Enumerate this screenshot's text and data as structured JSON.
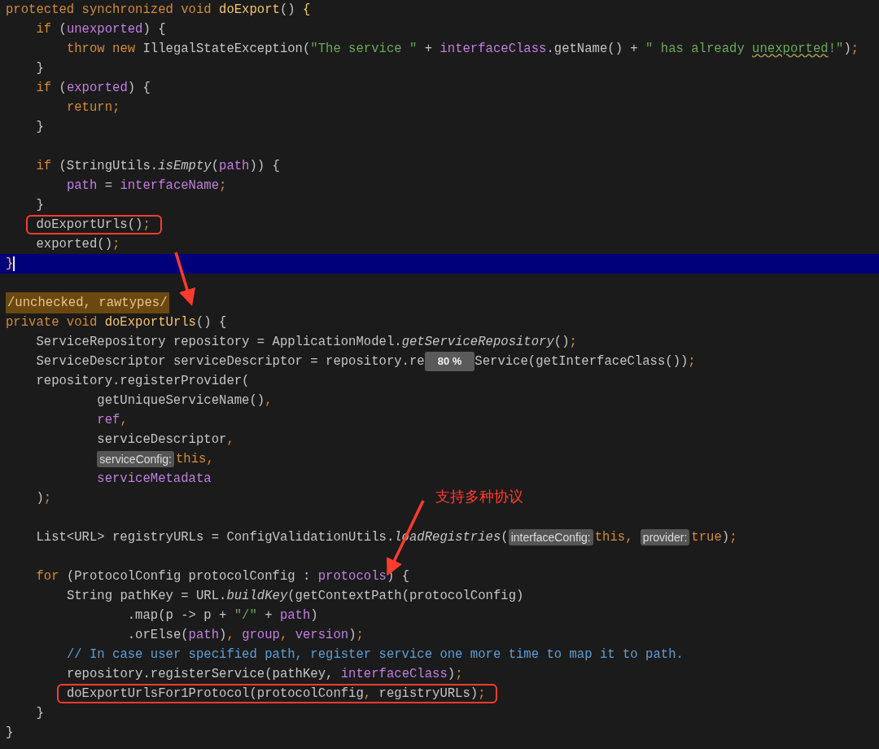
{
  "editor": {
    "lines": [
      {
        "kind": "code",
        "tokens": [
          {
            "kind": "kw",
            "text": "protected synchronized void "
          },
          {
            "kind": "fn",
            "text": "doExport"
          },
          {
            "kind": "plain",
            "text": "() "
          },
          {
            "kind": "fn",
            "text": "{"
          }
        ]
      },
      {
        "kind": "code",
        "tokens": [
          {
            "kind": "kw",
            "text": "    if "
          },
          {
            "kind": "plain",
            "text": "("
          },
          {
            "kind": "field",
            "text": "unexported"
          },
          {
            "kind": "plain",
            "text": ") {"
          }
        ]
      },
      {
        "kind": "code",
        "tokens": [
          {
            "kind": "kw",
            "text": "        throw new "
          },
          {
            "kind": "plain",
            "text": "IllegalStateException("
          },
          {
            "kind": "str",
            "text": "\"The service \""
          },
          {
            "kind": "plain",
            "text": " + "
          },
          {
            "kind": "field",
            "text": "interfaceClass"
          },
          {
            "kind": "plain",
            "text": ".getName() + "
          },
          {
            "kind": "str",
            "text": "\" has already "
          },
          {
            "kind": "strw",
            "text": "unexported"
          },
          {
            "kind": "str",
            "text": "!\""
          },
          {
            "kind": "plain",
            "text": ")"
          },
          {
            "kind": "punct",
            "text": ";"
          }
        ]
      },
      {
        "kind": "code",
        "tokens": [
          {
            "kind": "plain",
            "text": "    }"
          }
        ]
      },
      {
        "kind": "code",
        "tokens": [
          {
            "kind": "kw",
            "text": "    if "
          },
          {
            "kind": "plain",
            "text": "("
          },
          {
            "kind": "field",
            "text": "exported"
          },
          {
            "kind": "plain",
            "text": ") {"
          }
        ]
      },
      {
        "kind": "code",
        "tokens": [
          {
            "kind": "kw",
            "text": "        return;"
          }
        ]
      },
      {
        "kind": "code",
        "tokens": [
          {
            "kind": "plain",
            "text": "    }"
          }
        ]
      },
      {
        "kind": "blank"
      },
      {
        "kind": "code",
        "tokens": [
          {
            "kind": "kw",
            "text": "    if "
          },
          {
            "kind": "plain",
            "text": "(StringUtils."
          },
          {
            "kind": "italic",
            "text": "isEmpty"
          },
          {
            "kind": "plain",
            "text": "("
          },
          {
            "kind": "field",
            "text": "path"
          },
          {
            "kind": "plain",
            "text": ")) {"
          }
        ]
      },
      {
        "kind": "code",
        "tokens": [
          {
            "kind": "field",
            "text": "        path"
          },
          {
            "kind": "plain",
            "text": " = "
          },
          {
            "kind": "field",
            "text": "interfaceName"
          },
          {
            "kind": "punct",
            "text": ";"
          }
        ]
      },
      {
        "kind": "code",
        "tokens": [
          {
            "kind": "plain",
            "text": "    }"
          }
        ]
      },
      {
        "kind": "boxed",
        "tokens": [
          {
            "kind": "plain",
            "text": "    doExportUrls()"
          },
          {
            "kind": "punct",
            "text": ";"
          }
        ]
      },
      {
        "kind": "code",
        "tokens": [
          {
            "kind": "plain",
            "text": "    exported()"
          },
          {
            "kind": "punct",
            "text": ";"
          }
        ]
      },
      {
        "kind": "current",
        "tokens": [
          {
            "kind": "fn",
            "text": "}"
          }
        ]
      },
      {
        "kind": "blank"
      },
      {
        "kind": "code",
        "tokens": [
          {
            "kind": "annotation",
            "text": "/unchecked, rawtypes/"
          }
        ]
      },
      {
        "kind": "code",
        "tokens": [
          {
            "kind": "kw",
            "text": "private void "
          },
          {
            "kind": "fn",
            "text": "doExportUrls"
          },
          {
            "kind": "plain",
            "text": "() {"
          }
        ]
      },
      {
        "kind": "code",
        "tokens": [
          {
            "kind": "plain",
            "text": "    ServiceRepository repository = ApplicationModel."
          },
          {
            "kind": "italic",
            "text": "getServiceRepository"
          },
          {
            "kind": "plain",
            "text": "()"
          },
          {
            "kind": "punct",
            "text": ";"
          }
        ]
      },
      {
        "kind": "code",
        "tokens": [
          {
            "kind": "plain",
            "text": "    ServiceDescriptor serviceDescriptor = repository.re"
          },
          {
            "kind": "badge",
            "text": "80 %"
          },
          {
            "kind": "plain",
            "text": "Service(getInterfaceClass())"
          },
          {
            "kind": "punct",
            "text": ";"
          }
        ]
      },
      {
        "kind": "code",
        "tokens": [
          {
            "kind": "plain",
            "text": "    repository.registerProvider("
          }
        ]
      },
      {
        "kind": "code",
        "tokens": [
          {
            "kind": "plain",
            "text": "            getUniqueServiceName()"
          },
          {
            "kind": "punct",
            "text": ","
          }
        ]
      },
      {
        "kind": "code",
        "tokens": [
          {
            "kind": "field",
            "text": "            ref"
          },
          {
            "kind": "punct",
            "text": ","
          }
        ]
      },
      {
        "kind": "code",
        "tokens": [
          {
            "kind": "plain",
            "text": "            serviceDescriptor"
          },
          {
            "kind": "punct",
            "text": ","
          }
        ]
      },
      {
        "kind": "code",
        "tokens": [
          {
            "kind": "hint",
            "text": "            serviceConfig:"
          },
          {
            "kind": "kw",
            "text": "this,"
          }
        ]
      },
      {
        "kind": "code",
        "tokens": [
          {
            "kind": "field",
            "text": "            serviceMetadata"
          }
        ]
      },
      {
        "kind": "code",
        "tokens": [
          {
            "kind": "plain",
            "text": "    )"
          },
          {
            "kind": "punct",
            "text": ";"
          }
        ]
      },
      {
        "kind": "blank"
      },
      {
        "kind": "code",
        "tokens": [
          {
            "kind": "plain",
            "text": "    List<URL> registryURLs = ConfigValidationUtils."
          },
          {
            "kind": "italic",
            "text": "loadRegistries"
          },
          {
            "kind": "plain",
            "text": "("
          },
          {
            "kind": "hint",
            "text": "interfaceConfig:"
          },
          {
            "kind": "kw",
            "text": "this, "
          },
          {
            "kind": "hint",
            "text": "provider:"
          },
          {
            "kind": "kw",
            "text": "true"
          },
          {
            "kind": "plain",
            "text": ")"
          },
          {
            "kind": "punct",
            "text": ";"
          }
        ]
      },
      {
        "kind": "blank"
      },
      {
        "kind": "code",
        "tokens": [
          {
            "kind": "kw",
            "text": "    for "
          },
          {
            "kind": "plain",
            "text": "(ProtocolConfig protocolConfig : "
          },
          {
            "kind": "field",
            "text": "protocols"
          },
          {
            "kind": "plain",
            "text": ") {"
          }
        ]
      },
      {
        "kind": "code",
        "tokens": [
          {
            "kind": "plain",
            "text": "        String pathKey = URL."
          },
          {
            "kind": "italic",
            "text": "buildKey"
          },
          {
            "kind": "plain",
            "text": "(getContextPath(protocolConfig)"
          }
        ]
      },
      {
        "kind": "code",
        "tokens": [
          {
            "kind": "plain",
            "text": "                .map(p -> p + "
          },
          {
            "kind": "str",
            "text": "\"/\""
          },
          {
            "kind": "plain",
            "text": " + "
          },
          {
            "kind": "field",
            "text": "path"
          },
          {
            "kind": "plain",
            "text": ")"
          }
        ]
      },
      {
        "kind": "code",
        "tokens": [
          {
            "kind": "plain",
            "text": "                .orElse("
          },
          {
            "kind": "field",
            "text": "path"
          },
          {
            "kind": "plain",
            "text": ")"
          },
          {
            "kind": "punct",
            "text": ", "
          },
          {
            "kind": "field",
            "text": "group"
          },
          {
            "kind": "punct",
            "text": ", "
          },
          {
            "kind": "field",
            "text": "version"
          },
          {
            "kind": "plain",
            "text": ")"
          },
          {
            "kind": "punct",
            "text": ";"
          }
        ]
      },
      {
        "kind": "code",
        "tokens": [
          {
            "kind": "comment",
            "text": "        // In case user specified path, register service one more time to map it to path."
          }
        ]
      },
      {
        "kind": "code",
        "tokens": [
          {
            "kind": "plain",
            "text": "        repository.registerService(pathKey, "
          },
          {
            "kind": "field",
            "text": "interfaceClass"
          },
          {
            "kind": "plain",
            "text": ")"
          },
          {
            "kind": "punct",
            "text": ";"
          }
        ]
      },
      {
        "kind": "boxed",
        "tokens": [
          {
            "kind": "plain",
            "text": "        doExportUrlsFor1Protocol(protocolConfig"
          },
          {
            "kind": "punct",
            "text": ", "
          },
          {
            "kind": "plain",
            "text": "registryURLs)"
          },
          {
            "kind": "punct",
            "text": ";"
          }
        ]
      },
      {
        "kind": "code",
        "tokens": [
          {
            "kind": "plain",
            "text": "    }"
          }
        ]
      },
      {
        "kind": "code",
        "tokens": [
          {
            "kind": "plain",
            "text": "}"
          }
        ]
      }
    ]
  },
  "annotation": {
    "label": "支持多种协议"
  }
}
